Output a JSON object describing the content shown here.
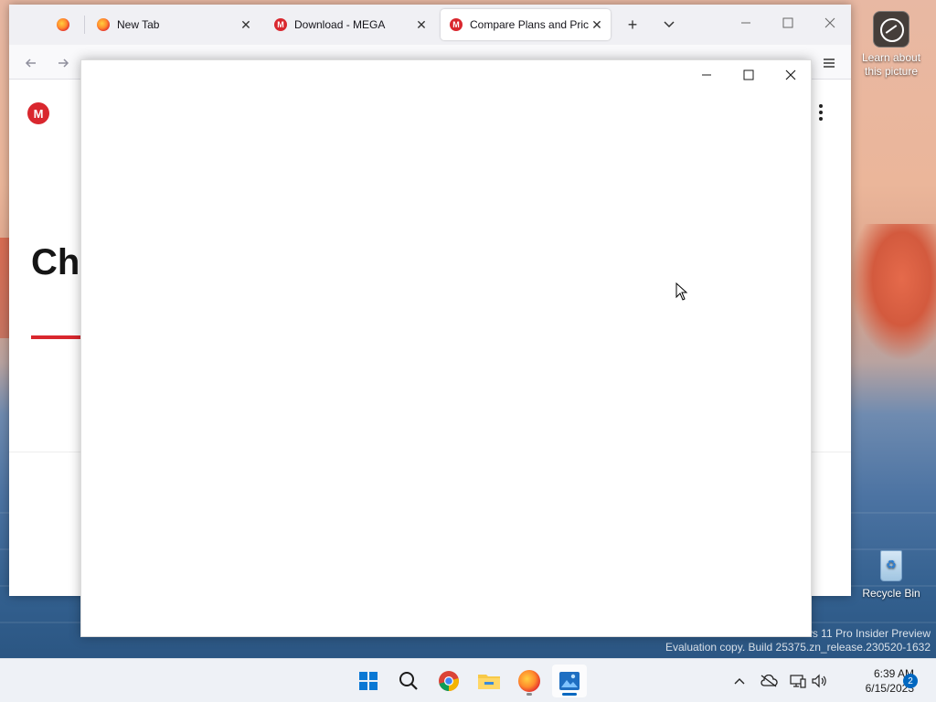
{
  "desktop": {
    "icons": [
      {
        "label": "Learn about this picture"
      },
      {
        "label": "Recycle Bin"
      }
    ],
    "watermark": {
      "line1": "ws 11 Pro Insider Preview",
      "line2": "Evaluation copy. Build 25375.zn_release.230520-1632"
    }
  },
  "browser": {
    "tabs": [
      {
        "label": "",
        "icon": "firefox-icon"
      },
      {
        "label": "New Tab",
        "icon": "firefox-icon"
      },
      {
        "label": "Download - MEGA",
        "icon": "mega-icon"
      },
      {
        "label": "Compare Plans and Pricin",
        "icon": "mega-icon",
        "active": true
      }
    ],
    "new_tab": "+",
    "tab_list": "⌄",
    "page": {
      "logo": "M",
      "heading": "Ch"
    }
  },
  "taskbar": {
    "apps": [
      "start-icon",
      "search-icon",
      "chrome-icon",
      "file-explorer-icon",
      "firefox-icon",
      "photos-icon"
    ],
    "clock": {
      "time": "6:39 AM",
      "date": "6/15/2023"
    },
    "notification_count": "2"
  },
  "colors": {
    "mega_red": "#d9272e",
    "accent_blue": "#0067c0"
  }
}
